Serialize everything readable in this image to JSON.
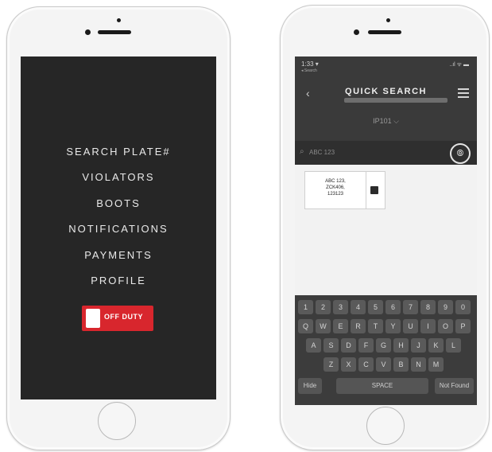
{
  "menu": {
    "items": [
      "SEARCH PLATE#",
      "VIOLATORS",
      "BOOTS",
      "NOTIFICATIONS",
      "PAYMENTS",
      "PROFILE"
    ],
    "duty_label": "OFF DUTY"
  },
  "status": {
    "time": "1:33 ▾",
    "sub": "◂ Search",
    "right": "..ıl ᯤ ▬"
  },
  "quick_search": {
    "title": "QUICK SEARCH",
    "back_label": "‹",
    "selector": "IP101 ⌵",
    "query": "ABC 123",
    "search_icon": "⌕",
    "camera_icon": "⦾",
    "result_text": "ABC 123,\nZCK406,\n123123"
  },
  "keyboard": {
    "rows": [
      [
        "1",
        "2",
        "3",
        "4",
        "5",
        "6",
        "7",
        "8",
        "9",
        "0"
      ],
      [
        "Q",
        "W",
        "E",
        "R",
        "T",
        "Y",
        "U",
        "I",
        "O",
        "P"
      ],
      [
        "A",
        "S",
        "D",
        "F",
        "G",
        "H",
        "J",
        "K",
        "L"
      ],
      [
        "Z",
        "X",
        "C",
        "V",
        "B",
        "N",
        "M"
      ]
    ],
    "hide_label": "Hide",
    "space_label": "SPACE",
    "not_found_label": "Not Found"
  }
}
